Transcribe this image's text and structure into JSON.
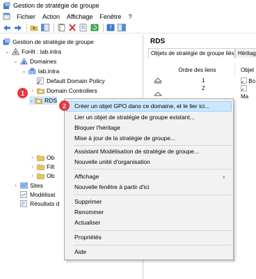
{
  "window": {
    "title": "Gestion de stratégie de groupe"
  },
  "menubar": {
    "items": [
      "Fichier",
      "Action",
      "Affichage",
      "Fenêtre",
      "?"
    ]
  },
  "tree": {
    "root": "Gestion de stratégie de groupe",
    "forest": "Forêt : lab.intra",
    "domains": "Domaines",
    "domain": "lab.intra",
    "default_policy": "Default Domain Policy",
    "domain_controllers": "Domain Controllers",
    "rds": "RDS",
    "ob1": "Ob",
    "fil": "Filt",
    "ob2": "Ob",
    "sites": "Sites",
    "modeling": "Modélisat",
    "results": "Résultats d"
  },
  "right_pane": {
    "title": "RDS",
    "tabs": [
      "Objets de stratégie de groupe liés",
      "Héritage"
    ],
    "columns": [
      "Ordre des liens",
      "Objet"
    ],
    "rows": [
      {
        "order": "1",
        "object": "Bo"
      },
      {
        "order": "2",
        "object": "Ma"
      }
    ]
  },
  "context_menu": {
    "items": [
      "Créer un objet GPO dans ce domaine, et le lier ici...",
      "Lier un objet de stratégie de groupe existant...",
      "Bloquer l'héritage",
      "Mise à jour de la stratégie de groupe...",
      "Assistant Modélisation de stratégie de groupe...",
      "Nouvelle unité d'organisation",
      "Affichage",
      "Nouvelle fenêtre à partir d'ici",
      "Supprimer",
      "Renommer",
      "Actualiser",
      "Propriétés",
      "Aide"
    ],
    "submenu_arrow": "›"
  },
  "badges": {
    "one": "1",
    "two": "2"
  },
  "colors": {
    "badge": "#e8373d",
    "highlight": "#cce8ff",
    "folder": "#e8c35a"
  }
}
